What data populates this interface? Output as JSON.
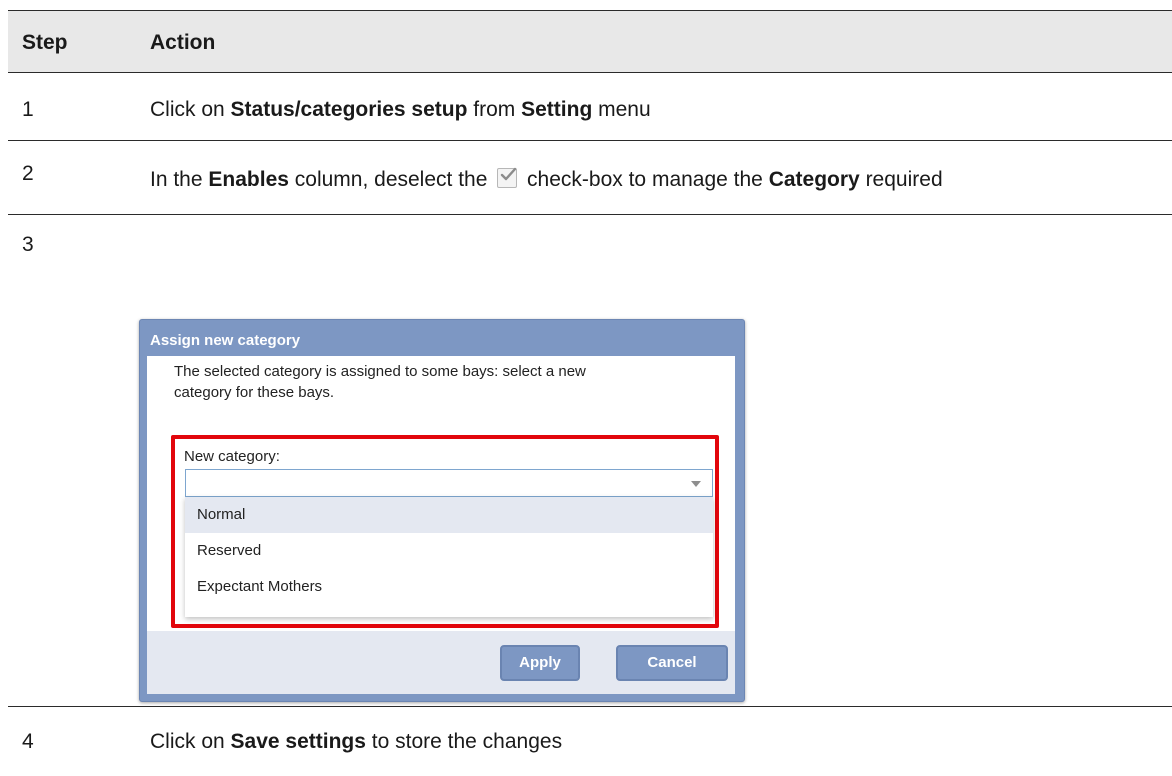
{
  "table": {
    "headers": {
      "step": "Step",
      "action": "Action"
    },
    "rows": [
      {
        "step": "1",
        "parts": [
          "Click on ",
          "Status/categories setup",
          " from ",
          "Setting",
          " menu"
        ]
      },
      {
        "step": "2",
        "parts": [
          "In the ",
          "Enables",
          " column, deselect the ",
          " check-box to manage the ",
          "Category",
          " required"
        ]
      },
      {
        "step": "3"
      },
      {
        "step": "4",
        "parts": [
          "Click on ",
          "Save settings",
          " to store the changes"
        ]
      }
    ]
  },
  "dialog": {
    "title": "Assign new category",
    "message": "The selected category is assigned to some bays: select a new category for these bays.",
    "field_label": "New category:",
    "selected_value": "",
    "options": [
      "Normal",
      "Reserved",
      "Expectant Mothers"
    ],
    "apply_label": "Apply",
    "cancel_label": "Cancel"
  },
  "icons": {
    "checkbox": "checked-checkbox-icon",
    "dropdown": "chevron-down-icon"
  },
  "colors": {
    "dialog_frame": "#7d97c3",
    "highlight": "#e2060c",
    "header_band": "#e8e8e8"
  }
}
